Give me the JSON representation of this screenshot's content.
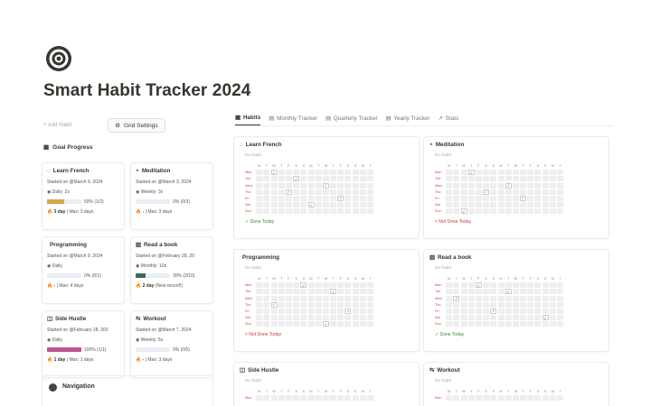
{
  "title": "Smart Habit Tracker 2024",
  "toolbar": {
    "add_habit": "+ Add Habit",
    "grid_settings": "Grid Settings"
  },
  "goal_progress": "Goal Progress",
  "colors": {
    "french": "#d4a64a",
    "meditation": "#dfe8f3",
    "programming": "#dfe8f3",
    "book": "#3a6b55",
    "side": "#c0528e",
    "workout": "#dfe8f3"
  },
  "goals": [
    {
      "name": "Learn French",
      "started": "Started on @March 9, 2024",
      "freq": "Daily: 2x",
      "pct": "50% (1/2)",
      "progress": 0.5,
      "streak_day": "3 day",
      "streak_rest": "| Max: 3 days",
      "color": "#d4a64a"
    },
    {
      "name": "Meditation",
      "started": "Started on @March 3, 2024",
      "freq": "Weekly: 3x",
      "pct": "0% (0/3)",
      "progress": 0,
      "streak_day": "-",
      "streak_rest": "| Max: 3 days",
      "color": "#dfe8f3"
    },
    {
      "name": "Programming",
      "started": "Started on @March 9, 2024",
      "freq": "Daily",
      "pct": "0% (0/1)",
      "progress": 0,
      "streak_day": "-",
      "streak_rest": "| Max: 4 days",
      "color": "#dfe8f3"
    },
    {
      "name": "Read a book",
      "started": "Started on @February 28, 20",
      "freq": "Monthly: 10x",
      "pct": "30% (3/10)",
      "progress": 0.3,
      "streak_day": "2 day",
      "streak_rest": "(New record!)",
      "color": "#3a6b55"
    },
    {
      "name": "Side Hustle",
      "started": "Started on @February 28, 202",
      "freq": "Daily",
      "pct": "100% (1/1)",
      "progress": 1,
      "streak_day": "1 day",
      "streak_rest": "| Max: 1 days",
      "color": "#c0528e"
    },
    {
      "name": "Workout",
      "started": "Started on @March 7, 2024",
      "freq": "Weekly: 5x",
      "pct": "0% (0/5)",
      "progress": 0,
      "streak_day": "-",
      "streak_rest": "| Max: 3 days",
      "color": "#dfe8f3"
    }
  ],
  "navigation": "Navigation",
  "tabs": [
    "Habits",
    "Monthly Tracker",
    "Quarterly Tracker",
    "Yearly Tracker",
    "Stats"
  ],
  "habits": [
    {
      "name": "Learn French",
      "sub": "Do habit",
      "status": "✓ Done Today",
      "status_type": "done"
    },
    {
      "name": "Meditation",
      "sub": "Do habit",
      "status": "× Not Done Today",
      "status_type": "not"
    },
    {
      "name": "Programming",
      "sub": "Do habit",
      "status": "× Not Done Today",
      "status_type": "not"
    },
    {
      "name": "Read a book",
      "sub": "Do habit",
      "status": "✓ Done Today",
      "status_type": "done"
    },
    {
      "name": "Side Hustle",
      "sub": "Do habit",
      "status": "",
      "status_type": "none"
    },
    {
      "name": "Workout",
      "sub": "Do habit",
      "status": "",
      "status_type": "none"
    }
  ],
  "grid_days": [
    "Mon",
    "Tue",
    "Wed",
    "Thu",
    "Fri",
    "Sat",
    "Sun"
  ]
}
